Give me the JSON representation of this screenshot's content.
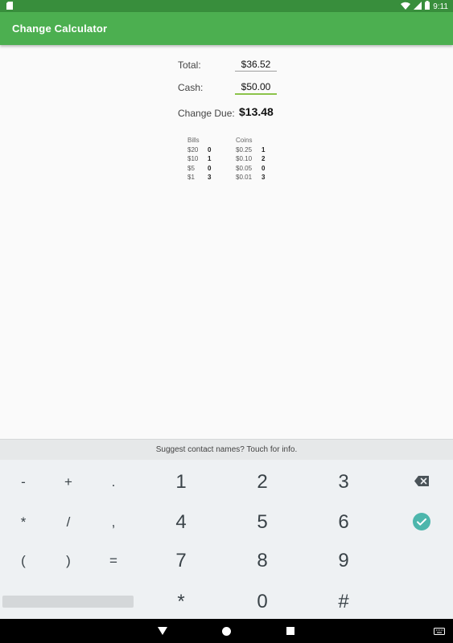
{
  "status_bar": {
    "time": "9:11"
  },
  "app_bar": {
    "title": "Change Calculator"
  },
  "form": {
    "total_label": "Total:",
    "total_value": "$36.52",
    "cash_label": "Cash:",
    "cash_value": "$50.00",
    "change_label": "Change Due:",
    "change_value": "$13.48"
  },
  "breakdown": {
    "bills_header": "Bills",
    "coins_header": "Coins",
    "bills": [
      {
        "denomination": "$20",
        "count": "0"
      },
      {
        "denomination": "$10",
        "count": "1"
      },
      {
        "denomination": "$5",
        "count": "0"
      },
      {
        "denomination": "$1",
        "count": "3"
      }
    ],
    "coins": [
      {
        "denomination": "$0.25",
        "count": "1"
      },
      {
        "denomination": "$0.10",
        "count": "2"
      },
      {
        "denomination": "$0.05",
        "count": "0"
      },
      {
        "denomination": "$0.01",
        "count": "3"
      }
    ]
  },
  "keyboard": {
    "suggestion": "Suggest contact names? Touch for info.",
    "symbol_keys": [
      "-",
      "+",
      ".",
      "*",
      "/",
      ",",
      "(",
      ")",
      "="
    ],
    "digit_keys": [
      "1",
      "2",
      "3",
      "4",
      "5",
      "6",
      "7",
      "8",
      "9",
      "*",
      "0",
      "#"
    ]
  },
  "colors": {
    "app_bar": "#4caf50",
    "status_bar": "#388e3c",
    "done_key": "#4db6ac",
    "cash_underline": "#8bc34a"
  }
}
